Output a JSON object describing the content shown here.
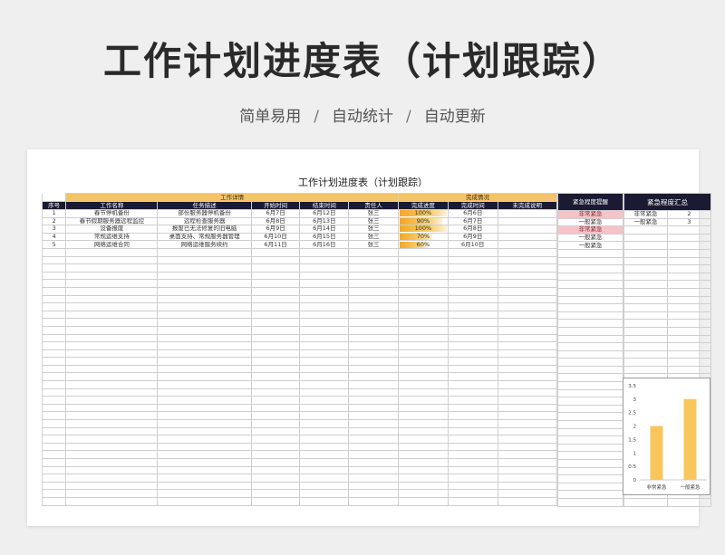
{
  "page": {
    "title": "工作计划进度表（计划跟踪）",
    "subtitle_parts": [
      "简单易用",
      "自动统计",
      "自动更新"
    ],
    "separator": "/"
  },
  "sheet": {
    "title": "工作计划进度表（计划跟踪）",
    "group_headers": {
      "details": "工作详情",
      "completion": "完成情况"
    },
    "columns": [
      "序号",
      "工作名称",
      "任务描述",
      "开始时间",
      "结束时间",
      "责任人",
      "完成进度",
      "完成时间",
      "未完成说明"
    ],
    "urgency_header": "紧急程度提醒",
    "rows": [
      {
        "no": "1",
        "name": "春节停机备份",
        "desc": "部份服务器停机备份",
        "start": "6月7日",
        "end": "6月12日",
        "owner": "张三",
        "progress": 100,
        "progress_label": "100%",
        "done": "6月6日",
        "note": "",
        "urgency": "非常紧急"
      },
      {
        "no": "2",
        "name": "春节假期服务器远程监控",
        "desc": "远程检查服务器",
        "start": "6月8日",
        "end": "6月13日",
        "owner": "张三",
        "progress": 90,
        "progress_label": "90%",
        "done": "6月7日",
        "note": "",
        "urgency": "一般紧急"
      },
      {
        "no": "3",
        "name": "设备报废",
        "desc": "报废已无法修复的旧电脑",
        "start": "6月9日",
        "end": "6月14日",
        "owner": "张三",
        "progress": 100,
        "progress_label": "100%",
        "done": "6月8日",
        "note": "",
        "urgency": "非常紧急"
      },
      {
        "no": "4",
        "name": "常规运维支持",
        "desc": "桌面支持、常规服务器管理",
        "start": "6月10日",
        "end": "6月15日",
        "owner": "张三",
        "progress": 70,
        "progress_label": "70%",
        "done": "6月9日",
        "note": "",
        "urgency": "一般紧急"
      },
      {
        "no": "5",
        "name": "网络运维合同",
        "desc": "网络运维服务续约",
        "start": "6月11日",
        "end": "6月16日",
        "owner": "张三",
        "progress": 60,
        "progress_label": "60%",
        "done": "6月10日",
        "note": "",
        "urgency": "一般紧急"
      }
    ],
    "summary": {
      "header": "紧急程度汇总",
      "rows": [
        {
          "label": "非常紧急",
          "count": "2"
        },
        {
          "label": "一般紧急",
          "count": "3"
        }
      ]
    },
    "colors": {
      "header_dark": "#1a1a33",
      "group_orange": "#f6c26a",
      "urgent_pink": "#f6c3c9",
      "bar_orange": "#f9c65c"
    }
  },
  "chart_data": {
    "type": "bar",
    "categories": [
      "非常紧急",
      "一般紧急"
    ],
    "values": [
      2,
      3
    ],
    "ylim": [
      0,
      3.5
    ],
    "yticks": [
      "0",
      "0.5",
      "1",
      "1.5",
      "2",
      "2.5",
      "3",
      "3.5"
    ],
    "grid": false
  }
}
